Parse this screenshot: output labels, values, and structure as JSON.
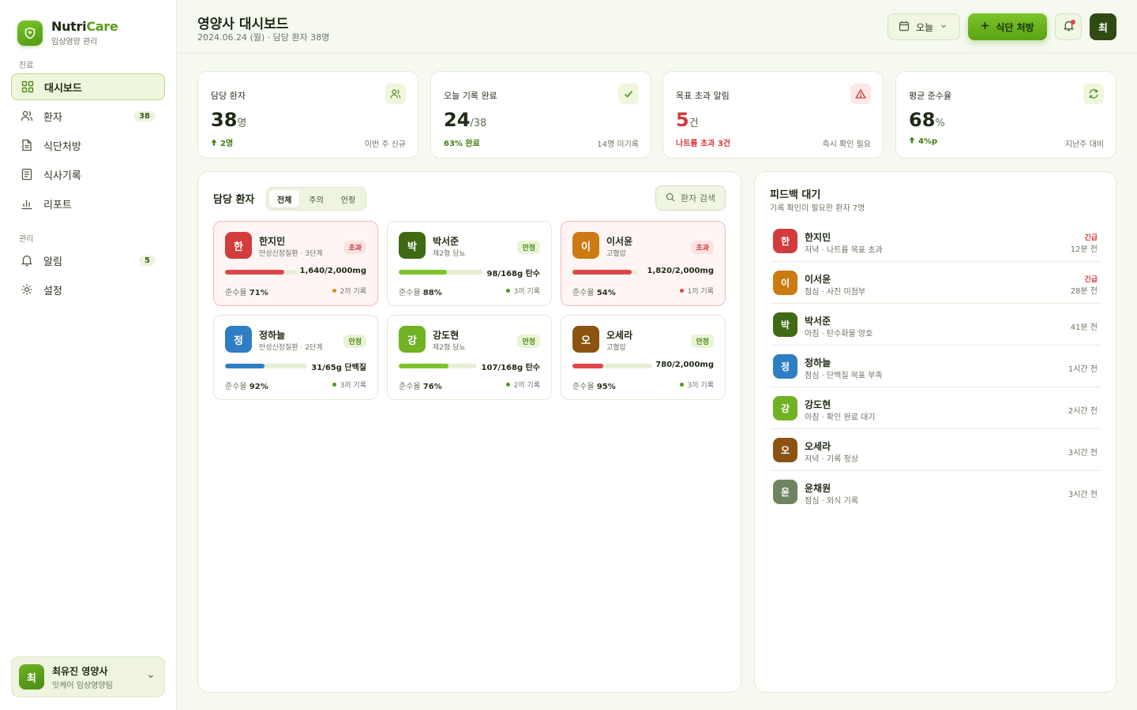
{
  "brand": {
    "name_main": "Nutri",
    "name_accent": "Care",
    "subtitle": "임상영양 관리"
  },
  "sidebar": {
    "section_clinical": "진료",
    "section_admin": "관리",
    "items": [
      {
        "label": "대시보드",
        "icon": "grid-icon"
      },
      {
        "label": "환자",
        "icon": "users-icon",
        "badge": "38"
      },
      {
        "label": "식단처방",
        "icon": "document-icon"
      },
      {
        "label": "식사기록",
        "icon": "list-icon"
      },
      {
        "label": "리포트",
        "icon": "bar-chart-icon"
      },
      {
        "label": "알림",
        "icon": "bell-icon",
        "badge": "5"
      },
      {
        "label": "설정",
        "icon": "gear-icon"
      }
    ],
    "user": {
      "initial": "최",
      "name": "최유진 영양사",
      "team": "잇케어 임상영양팀"
    }
  },
  "header": {
    "title": "영양사 대시보드",
    "subtitle": "2024.06.24 (월) · 담당 환자 38명",
    "date_button": "오늘",
    "primary_button": "식단 처방",
    "avatar_initial": "최"
  },
  "stats": [
    {
      "label": "담당 환자",
      "value": "38",
      "unit": "명",
      "foot": "2명",
      "note": "이번 주 신규",
      "icon": "users-icon",
      "value_color": "#1f2a14",
      "foot_color": "#3f7f12"
    },
    {
      "label": "오늘 기록 완료",
      "value": "24",
      "unit": "/38",
      "foot": "63% 완료",
      "note": "14명 미기록",
      "icon": "check-icon",
      "value_color": "#1f2a14",
      "foot_color": "#3f7f12"
    },
    {
      "label": "목표 초과 알림",
      "value": "5",
      "unit": "건",
      "foot": "나트륨 초과 3건",
      "note": "즉시 확인 필요",
      "icon": "warning-icon",
      "value_color": "#d23a3a",
      "foot_color": "#d23a3a"
    },
    {
      "label": "평균 준수율",
      "value": "68",
      "unit": "%",
      "foot": "4%p",
      "note": "지난주 대비",
      "icon": "refresh-icon",
      "value_color": "#1f2a14",
      "foot_color": "#3f7f12"
    }
  ],
  "patients_panel": {
    "title": "담당 환자",
    "tabs": [
      "전체",
      "주의",
      "안정"
    ],
    "search_placeholder": "환자 검색",
    "rate_label": "준수율",
    "patients": [
      {
        "initial": "한",
        "name": "한지민",
        "condition": "만성신장질환 · 3단계",
        "status": "초과",
        "alert": true,
        "progress": 0.82,
        "value": "1,640/2,000mg",
        "rate": "71%",
        "records": "2끼 기록",
        "avatar_color": "#d33c3c",
        "bar_color": "#e04646",
        "dot_color": "#e08a1e"
      },
      {
        "initial": "박",
        "name": "박서준",
        "condition": "제2형 당뇨",
        "status": "안정",
        "alert": false,
        "progress": 0.58,
        "value": "98/168g 탄수",
        "rate": "88%",
        "records": "3끼 기록",
        "avatar_color": "#3f6a14",
        "bar_color": "#7cc42a",
        "dot_color": "#4a9a18"
      },
      {
        "initial": "이",
        "name": "이서윤",
        "condition": "고혈압",
        "status": "초과",
        "alert": true,
        "progress": 0.91,
        "value": "1,820/2,000mg",
        "rate": "54%",
        "records": "1끼 기록",
        "avatar_color": "#cc7a12",
        "bar_color": "#e04646",
        "dot_color": "#e04646"
      },
      {
        "initial": "정",
        "name": "정하늘",
        "condition": "만성신장질환 · 2단계",
        "status": "안정",
        "alert": false,
        "progress": 0.48,
        "value": "31/65g 단백질",
        "rate": "92%",
        "records": "3끼 기록",
        "avatar_color": "#2f7ec4",
        "bar_color": "#2f7ec4",
        "dot_color": "#4a9a18"
      },
      {
        "initial": "강",
        "name": "강도현",
        "condition": "제2형 당뇨",
        "status": "안정",
        "alert": false,
        "progress": 0.64,
        "value": "107/168g 탄수",
        "rate": "76%",
        "records": "2끼 기록",
        "avatar_color": "#6fb224",
        "bar_color": "#7cc42a",
        "dot_color": "#4a9a18"
      },
      {
        "initial": "오",
        "name": "오세라",
        "condition": "고혈압",
        "status": "안정",
        "alert": false,
        "progress": 0.39,
        "value": "780/2,000mg",
        "rate": "95%",
        "records": "3끼 기록",
        "avatar_color": "#8a5410",
        "bar_color": "#e04646",
        "dot_color": "#4a9a18"
      }
    ]
  },
  "feedback_panel": {
    "title": "피드백 대기",
    "subtitle": "기록 확인이 필요한 환자 7명",
    "urgent_label": "긴급",
    "items": [
      {
        "initial": "한",
        "name": "한지민",
        "desc": "저녁 · 나트륨 목표 초과",
        "time": "12분 전",
        "urgent": true,
        "avatar_color": "#d33c3c"
      },
      {
        "initial": "이",
        "name": "이서윤",
        "desc": "점심 · 사진 미첨부",
        "time": "28분 전",
        "urgent": true,
        "avatar_color": "#cc7a12"
      },
      {
        "initial": "박",
        "name": "박서준",
        "desc": "아침 · 탄수화물 양호",
        "time": "41분 전",
        "urgent": false,
        "avatar_color": "#3f6a14"
      },
      {
        "initial": "정",
        "name": "정하늘",
        "desc": "점심 · 단백질 목표 부족",
        "time": "1시간 전",
        "urgent": false,
        "avatar_color": "#2f7ec4"
      },
      {
        "initial": "강",
        "name": "강도현",
        "desc": "아침 · 확인 완료 대기",
        "time": "2시간 전",
        "urgent": false,
        "avatar_color": "#6fb224"
      },
      {
        "initial": "오",
        "name": "오세라",
        "desc": "저녁 · 기록 정상",
        "time": "3시간 전",
        "urgent": false,
        "avatar_color": "#8a5410"
      },
      {
        "initial": "윤",
        "name": "윤채원",
        "desc": "점심 · 외식 기록",
        "time": "3시간 전",
        "urgent": false,
        "avatar_color": "#6e8460"
      }
    ]
  }
}
